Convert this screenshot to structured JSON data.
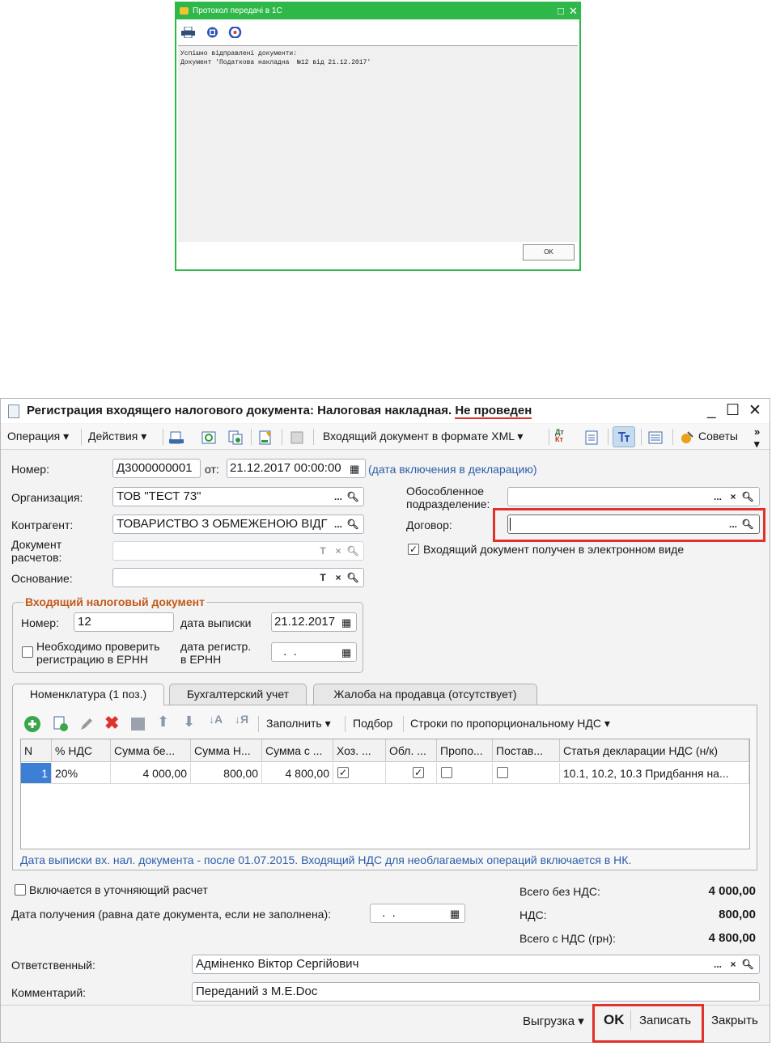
{
  "protocol_dialog": {
    "title": "Протокол передачі в 1С",
    "messages": [
      "Успішно відправлені документи:",
      "Документ 'Податкова накладна  №12 від 21.12.2017'"
    ],
    "ok_label": "OK",
    "toolbar_icons": [
      "print-icon",
      "save-icon",
      "refresh-icon"
    ]
  },
  "window": {
    "title": "Регистрация входящего налогового документа: Налоговая накладная.",
    "status": "Не проведен"
  },
  "toolbar": {
    "operation": "Операция",
    "actions": "Действия",
    "xml_doc": "Входящий документ в формате XML",
    "tips": "Советы"
  },
  "form": {
    "number_label": "Номер:",
    "number_value": "Д3000000001",
    "from_label": "от:",
    "date_value": "21.12.2017 00:00:00",
    "date_link": "(дата включения в декларацию)",
    "org_label": "Организация:",
    "org_value": "ТОВ \"ТЕСТ 73\"",
    "counterparty_label": "Контрагент:",
    "counterparty_value": "ТОВАРИСТВО З ОБМЕЖЕНОЮ ВІДГ",
    "settlement_doc_label_1": "Документ",
    "settlement_doc_label_2": "расчетов:",
    "basis_label": "Основание:",
    "subdivision_label_1": "Обособленное",
    "subdivision_label_2": "подразделение:",
    "contract_label": "Договор:",
    "electronic_label": "Входящий документ получен в электронном виде",
    "electronic_checked": true
  },
  "incoming": {
    "group_title": "Входящий налоговый документ",
    "number_label": "Номер:",
    "number_value": "12",
    "issue_label": "дата выписки",
    "issue_value": "21.12.2017",
    "check_label_1": "Необходимо проверить",
    "check_label_2": "регистрацию в ЕРНН",
    "reg_label_1": "дата регистр.",
    "reg_label_2": "в ЕРНН",
    "reg_value": " .  ."
  },
  "tabs": [
    {
      "label": "Номенклатура (1 поз.)"
    },
    {
      "label": "Бухгалтерский учет"
    },
    {
      "label": "Жалоба на продавца (отсутствует)"
    }
  ],
  "table_toolbar": {
    "fill": "Заполнить",
    "selection": "Подбор",
    "proportional": "Строки по пропорциональному НДС"
  },
  "table": {
    "columns": [
      "N",
      "% НДС",
      "Сумма бе...",
      "Сумма Н...",
      "Сумма с ...",
      "Хоз. ...",
      "Обл. ...",
      "Пропо...",
      "Постав...",
      "Статья декларации НДС (н/к)"
    ],
    "rows": [
      {
        "n": "1",
        "vat": "20%",
        "sum_without": "4 000,00",
        "sum_vat": "800,00",
        "sum_with": "4 800,00",
        "hoz": true,
        "obl": true,
        "propo": false,
        "postav": false,
        "article": "10.1, 10.2, 10.3 Придбання на..."
      }
    ]
  },
  "note": "Дата выписки вх. нал. документа - после 01.07.2015. Входящий НДС для необлагаемых операций включается в НК.",
  "footer": {
    "refine_label": "Включается в уточняющий расчет",
    "receive_label": "Дата получения (равна дате документа, если не заполнена):",
    "receive_value": " .  .",
    "total_wo_label": "Всего без НДС:",
    "total_wo_value": "4 000,00",
    "vat_label": "НДС:",
    "vat_value": "800,00",
    "total_label": "Всего с НДС (грн):",
    "total_value": "4 800,00",
    "responsible_label": "Ответственный:",
    "responsible_value": "Адміненко Віктор Сергійович",
    "comment_label": "Комментарий:",
    "comment_value": "Переданий з M.E.Doc"
  },
  "buttons": {
    "export": "Выгрузка",
    "ok": "OK",
    "save": "Записать",
    "close": "Закрыть"
  },
  "colors": {
    "dialog_green": "#2fb84a",
    "highlight_red": "#e1312b",
    "group_title_orange": "#c25a1a",
    "link_blue": "#2d5ea8"
  }
}
